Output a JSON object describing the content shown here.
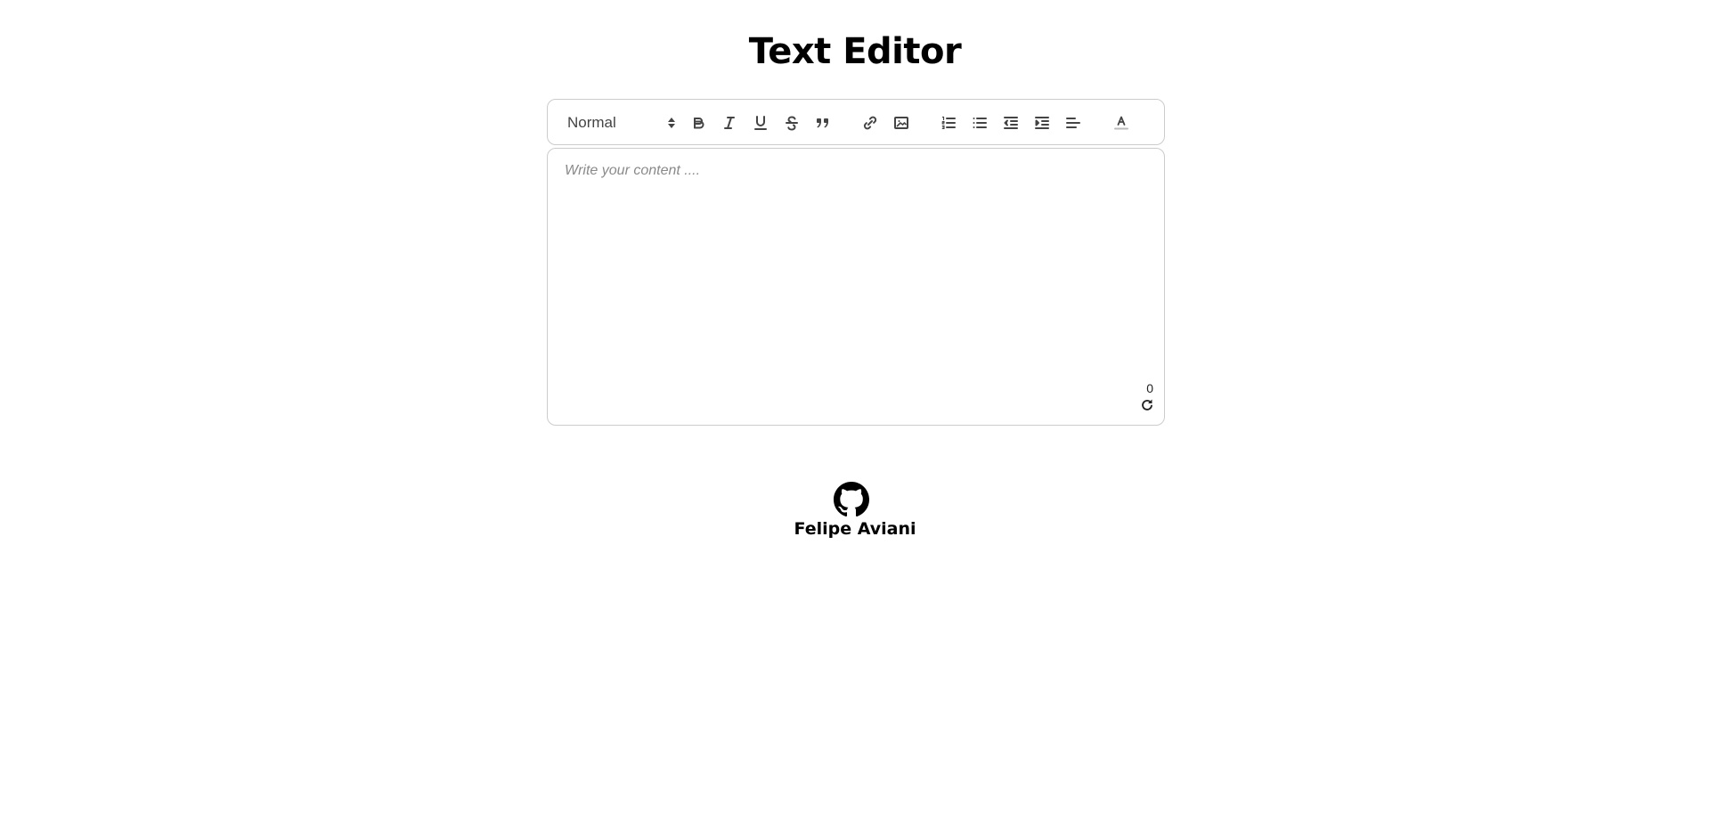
{
  "page": {
    "title": "Text Editor"
  },
  "toolbar": {
    "header_picker": {
      "selected": "Normal"
    },
    "buttons": [
      {
        "name": "bold-button",
        "icon": "bold-icon"
      },
      {
        "name": "italic-button",
        "icon": "italic-icon"
      },
      {
        "name": "underline-button",
        "icon": "underline-icon"
      },
      {
        "name": "strike-button",
        "icon": "strikethrough-icon"
      },
      {
        "name": "blockquote-button",
        "icon": "quote-icon"
      },
      {
        "name": "link-button",
        "icon": "link-icon"
      },
      {
        "name": "image-button",
        "icon": "image-icon"
      },
      {
        "name": "ordered-list-button",
        "icon": "ordered-list-icon"
      },
      {
        "name": "bullet-list-button",
        "icon": "bullet-list-icon"
      },
      {
        "name": "outdent-button",
        "icon": "outdent-icon"
      },
      {
        "name": "indent-button",
        "icon": "indent-icon"
      },
      {
        "name": "align-button",
        "icon": "align-left-icon"
      },
      {
        "name": "text-color-button",
        "icon": "font-color-icon"
      }
    ]
  },
  "editor": {
    "placeholder": "Write your content ....",
    "value": "",
    "char_count": "0",
    "reset_icon": "refresh-icon"
  },
  "footer": {
    "author": "Felipe Aviani",
    "icon": "github-icon"
  },
  "colors": {
    "border": "#cccccc",
    "icon_stroke": "#444444",
    "placeholder": "#8a8a8a"
  }
}
